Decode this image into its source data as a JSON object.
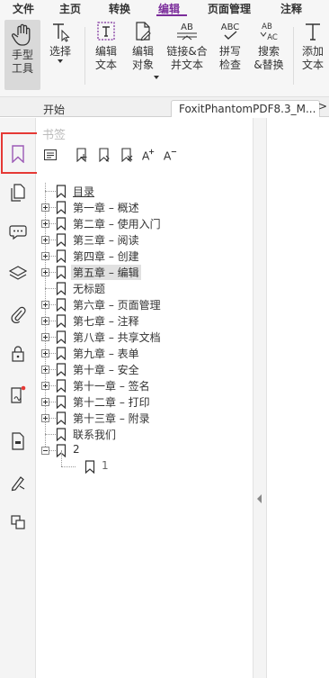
{
  "menu": {
    "items": [
      "文件",
      "主页",
      "转换",
      "编辑",
      "页面管理",
      "注释"
    ],
    "active": "编辑"
  },
  "ribbon": {
    "hand_tool": "手型\n工具",
    "select": "选择",
    "edit_text": "编辑\n文本",
    "edit_object": "编辑\n对象",
    "link_merge": "链接&合\n并文本",
    "spell_check": "拼写\n检查",
    "search_replace": "搜索\n&替换",
    "add_text": "添加\n文本",
    "abc_icon_text": "ABC",
    "ab_icon_text": "AB",
    "ab_ac_text": "AB\nAC"
  },
  "tabs": {
    "start": "开始",
    "document": "FoxitPhantomPDF8.3_M...",
    "more": ">"
  },
  "left_rail": {
    "icons": [
      "bookmark-icon",
      "pages-icon",
      "comment-icon",
      "layers-icon",
      "attachment-icon",
      "security-icon",
      "signature-panel-icon",
      "form-field-icon",
      "pen-icon",
      "content-icon"
    ],
    "highlight_color": "#e53935"
  },
  "bookmark_panel": {
    "title": "书签",
    "items": [
      {
        "label": "目录",
        "has_children": false,
        "selected": false,
        "underline": true
      },
      {
        "label": "第一章 – 概述",
        "has_children": true,
        "selected": false
      },
      {
        "label": "第二章 – 使用入门",
        "has_children": true,
        "selected": false
      },
      {
        "label": "第三章 – 阅读",
        "has_children": true,
        "selected": false
      },
      {
        "label": "第四章 – 创建",
        "has_children": true,
        "selected": false
      },
      {
        "label": "第五章 – 编辑",
        "has_children": true,
        "selected": true
      },
      {
        "label": "无标题",
        "has_children": false,
        "selected": false
      },
      {
        "label": "第六章 – 页面管理",
        "has_children": true,
        "selected": false
      },
      {
        "label": "第七章 – 注释",
        "has_children": true,
        "selected": false
      },
      {
        "label": "第八章 – 共享文档",
        "has_children": true,
        "selected": false
      },
      {
        "label": "第九章 – 表单",
        "has_children": true,
        "selected": false
      },
      {
        "label": "第十章 – 安全",
        "has_children": true,
        "selected": false
      },
      {
        "label": "第十一章 – 签名",
        "has_children": true,
        "selected": false
      },
      {
        "label": "第十二章 – 打印",
        "has_children": true,
        "selected": false
      },
      {
        "label": "第十三章 – 附录",
        "has_children": true,
        "selected": false
      },
      {
        "label": "联系我们",
        "has_children": false,
        "selected": false
      },
      {
        "label": "2",
        "has_children": true,
        "expanded": true,
        "selected": false
      },
      {
        "label": "1",
        "child": true,
        "selected": false
      }
    ]
  },
  "colors": {
    "accent": "#7b2d9b",
    "bookmark_icon": "#9b59b6"
  }
}
